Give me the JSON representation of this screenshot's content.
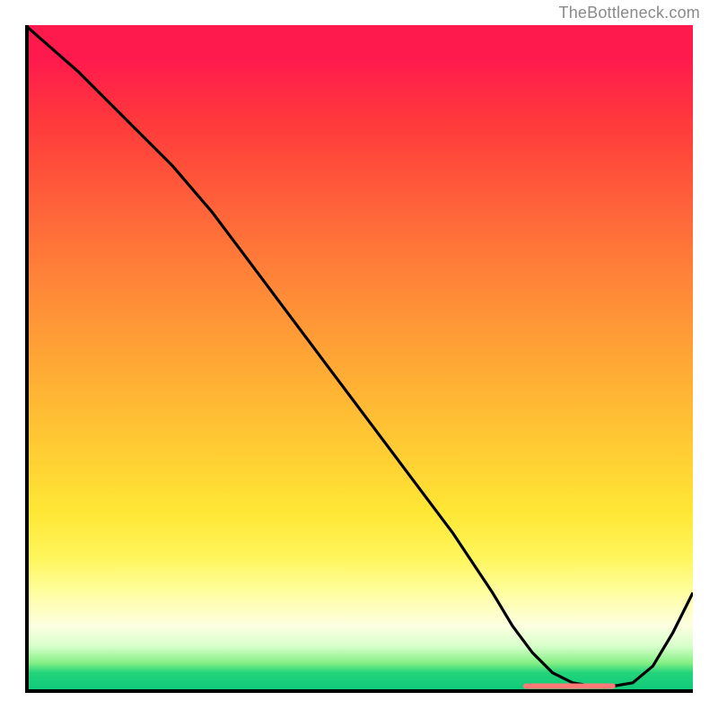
{
  "watermark": "TheBottleneck.com",
  "chart_data": {
    "type": "line",
    "title": "",
    "xlabel": "",
    "ylabel": "",
    "xlim": [
      0,
      100
    ],
    "ylim": [
      0,
      100
    ],
    "series": [
      {
        "name": "curve",
        "x": [
          0,
          8,
          16,
          22,
          28,
          34,
          40,
          46,
          52,
          58,
          64,
          70,
          73,
          76,
          79,
          82,
          85,
          88,
          91,
          94,
          97,
          100
        ],
        "y": [
          100,
          93,
          85,
          79,
          72,
          64,
          56,
          48,
          40,
          32,
          24,
          15,
          10,
          6,
          3,
          1.5,
          1,
          1,
          1.5,
          4,
          9,
          15
        ]
      }
    ],
    "highlight": {
      "name": "bottom-segment",
      "x_start": 75,
      "x_end": 88,
      "y": 1,
      "color": "#ff7a76"
    },
    "gradient_stops": [
      {
        "pct": 0,
        "color": "#ff1a4d"
      },
      {
        "pct": 50,
        "color": "#ffa635"
      },
      {
        "pct": 80,
        "color": "#fff65e"
      },
      {
        "pct": 97,
        "color": "#22d37b"
      },
      {
        "pct": 100,
        "color": "#0cc97a"
      }
    ]
  }
}
